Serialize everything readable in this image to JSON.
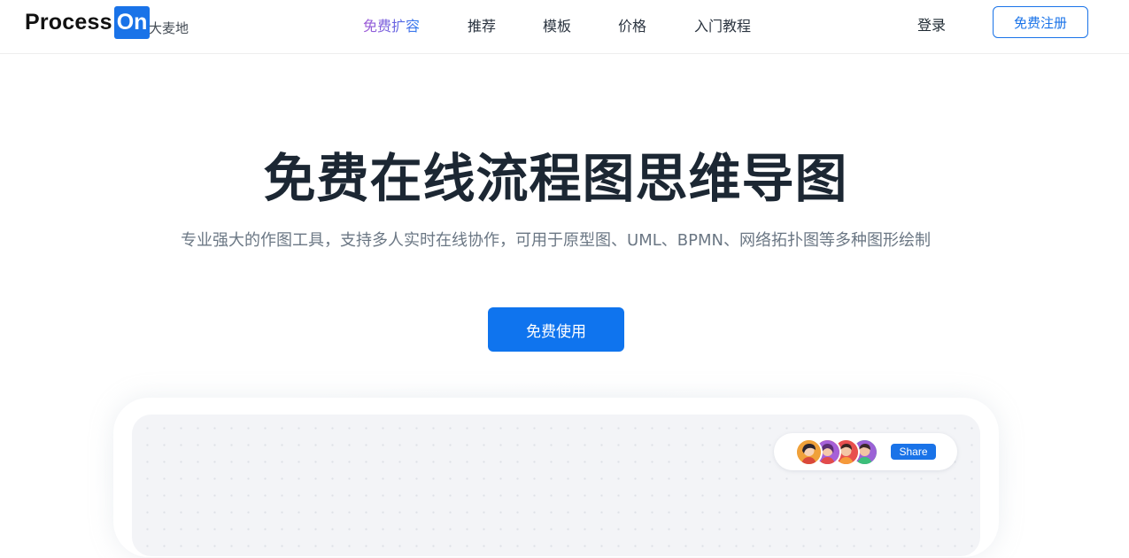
{
  "header": {
    "logo_text": "Process",
    "logo_badge": "On",
    "logo_subtitle": "大麦地",
    "nav": [
      {
        "label": "免费扩容"
      },
      {
        "label": "推荐"
      },
      {
        "label": "模板"
      },
      {
        "label": "价格"
      },
      {
        "label": "入门教程"
      }
    ],
    "login_label": "登录",
    "register_label": "免费注册"
  },
  "hero": {
    "title": "免费在线流程图思维导图",
    "subtitle": "专业强大的作图工具，支持多人实时在线协作，可用于原型图、UML、BPMN、网络拓扑图等多种图形绘制",
    "cta_label": "免费使用"
  },
  "preview": {
    "share_label": "Share",
    "avatars": [
      "avatar-1",
      "avatar-2",
      "avatar-3",
      "avatar-4"
    ]
  },
  "colors": {
    "accent": "#1a73e8",
    "cta": "#0f74ee",
    "title": "#1c2733",
    "subtitle": "#6b7784"
  }
}
